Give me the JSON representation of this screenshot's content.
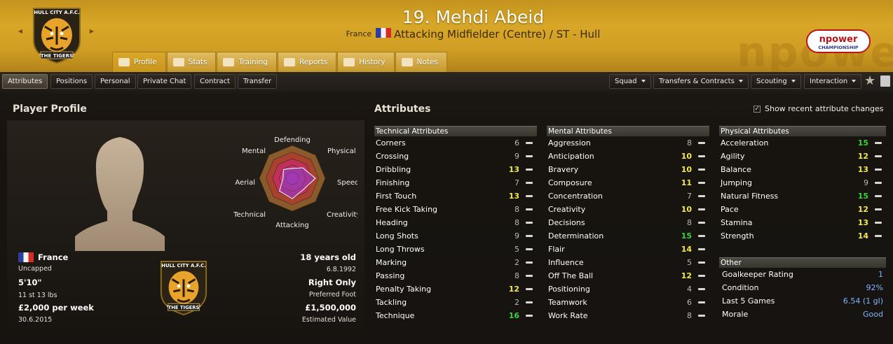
{
  "header": {
    "player_name": "19. Mehdi Abeid",
    "nationality": "France",
    "position_club": "Attacking Midfielder (Centre) / ST - Hull",
    "club_crest_text_top": "HULL CITY A.F.C.",
    "club_crest_text_bottom": "'THE TIGERS'",
    "league_logo_top": "npower",
    "league_logo_bottom": "CHAMPIONSHIP",
    "watermark": "npowe"
  },
  "tabs": [
    {
      "label": "Profile",
      "icon": "profile-icon"
    },
    {
      "label": "Stats",
      "icon": "stats-icon"
    },
    {
      "label": "Training",
      "icon": "training-icon"
    },
    {
      "label": "Reports",
      "icon": "reports-icon"
    },
    {
      "label": "History",
      "icon": "history-icon"
    },
    {
      "label": "Notes",
      "icon": "notes-icon"
    }
  ],
  "subnav": {
    "left": [
      "Attributes",
      "Positions",
      "Personal",
      "Private Chat",
      "Contract",
      "Transfer"
    ],
    "right": [
      "Squad",
      "Transfers & Contracts",
      "Scouting",
      "Interaction"
    ]
  },
  "profile": {
    "title": "Player Profile",
    "radar_labels": {
      "defending": "Defending",
      "physical": "Physical",
      "speed": "Speed",
      "creativity": "Creativity",
      "attacking": "Attacking",
      "technical": "Technical",
      "aerial": "Aerial",
      "mental": "Mental"
    },
    "radar_values": {
      "defending": 0.3,
      "physical": 0.45,
      "speed": 0.7,
      "creativity": 0.48,
      "attacking": 0.62,
      "technical": 0.55,
      "aerial": 0.28,
      "mental": 0.38
    },
    "nationality": "France",
    "caps": "Uncapped",
    "height": "5'10\"",
    "weight": "11 st 13 lbs",
    "wage": "£2,000 per week",
    "contract_end": "30.6.2015",
    "age": "18 years old",
    "dob": "6.8.1992",
    "foot": "Right Only",
    "foot_label": "Preferred Foot",
    "value": "£1,500,000",
    "value_label": "Estimated Value"
  },
  "attributes": {
    "title": "Attributes",
    "show_changes": "Show recent attribute changes",
    "technical": {
      "header": "Technical Attributes",
      "rows": [
        [
          "Corners",
          "6"
        ],
        [
          "Crossing",
          "9"
        ],
        [
          "Dribbling",
          "13"
        ],
        [
          "Finishing",
          "7"
        ],
        [
          "First Touch",
          "13"
        ],
        [
          "Free Kick Taking",
          "8"
        ],
        [
          "Heading",
          "8"
        ],
        [
          "Long Shots",
          "9"
        ],
        [
          "Long Throws",
          "5"
        ],
        [
          "Marking",
          "2"
        ],
        [
          "Passing",
          "8"
        ],
        [
          "Penalty Taking",
          "12"
        ],
        [
          "Tackling",
          "2"
        ],
        [
          "Technique",
          "16"
        ]
      ]
    },
    "mental": {
      "header": "Mental Attributes",
      "rows": [
        [
          "Aggression",
          "8"
        ],
        [
          "Anticipation",
          "10"
        ],
        [
          "Bravery",
          "10"
        ],
        [
          "Composure",
          "11"
        ],
        [
          "Concentration",
          "7"
        ],
        [
          "Creativity",
          "10"
        ],
        [
          "Decisions",
          "8"
        ],
        [
          "Determination",
          "15"
        ],
        [
          "Flair",
          "14"
        ],
        [
          "Influence",
          "5"
        ],
        [
          "Off The Ball",
          "12"
        ],
        [
          "Positioning",
          "4"
        ],
        [
          "Teamwork",
          "6"
        ],
        [
          "Work Rate",
          "8"
        ]
      ]
    },
    "physical": {
      "header": "Physical Attributes",
      "rows": [
        [
          "Acceleration",
          "15"
        ],
        [
          "Agility",
          "12"
        ],
        [
          "Balance",
          "13"
        ],
        [
          "Jumping",
          "9"
        ],
        [
          "Natural Fitness",
          "15"
        ],
        [
          "Pace",
          "12"
        ],
        [
          "Stamina",
          "13"
        ],
        [
          "Strength",
          "14"
        ]
      ]
    },
    "other": {
      "header": "Other",
      "rows": [
        [
          "Goalkeeper Rating",
          "1"
        ],
        [
          "Condition",
          "92%"
        ],
        [
          "Last 5 Games",
          "6.54 (1 gl)"
        ],
        [
          "Morale",
          "Good"
        ]
      ]
    }
  },
  "colors": {
    "header_gold": "#d8a727",
    "attr_high": "#39d339",
    "attr_mid": "#f2e94a",
    "attr_low": "#b8b8b8",
    "other_value": "#7fb7ff"
  }
}
